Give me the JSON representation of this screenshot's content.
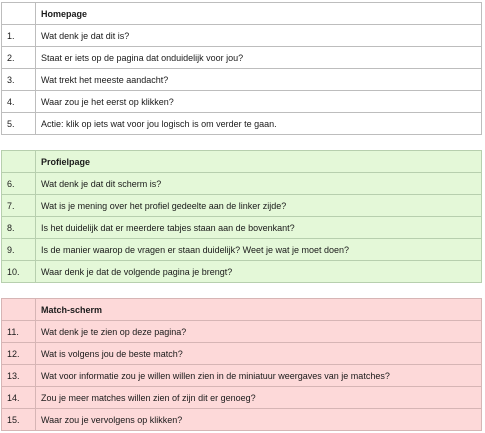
{
  "sections": [
    {
      "title": "Homepage",
      "rows": [
        {
          "num": "1.",
          "text": "Wat denk je dat dit is?"
        },
        {
          "num": "2.",
          "text": "Staat er iets op de pagina dat onduidelijk voor jou?"
        },
        {
          "num": "3.",
          "text": "Wat trekt het meeste aandacht?"
        },
        {
          "num": "4.",
          "text": "Waar zou je het eerst op klikken?"
        },
        {
          "num": "5.",
          "text": "Actie: klik op iets wat voor jou logisch is om verder te gaan."
        }
      ]
    },
    {
      "title": "Profielpage",
      "rows": [
        {
          "num": "6.",
          "text": "Wat denk je dat dit scherm is?"
        },
        {
          "num": "7.",
          "text": "Wat is je mening over het profiel gedeelte aan de linker zijde?"
        },
        {
          "num": "8.",
          "text": "Is het duidelijk dat er meerdere tabjes staan aan de bovenkant?"
        },
        {
          "num": "9.",
          "text": "Is de manier waarop de vragen er staan duidelijk? Weet je wat je moet doen?"
        },
        {
          "num": "10.",
          "text": "Waar denk je dat de volgende pagina je brengt?"
        }
      ]
    },
    {
      "title": "Match-scherm",
      "rows": [
        {
          "num": "11.",
          "text": "Wat denk je te zien op deze pagina?"
        },
        {
          "num": "12.",
          "text": "Wat is volgens jou de beste match?"
        },
        {
          "num": "13.",
          "text": "Wat voor informatie zou je willen willen zien in de miniatuur weergaves van je matches?"
        },
        {
          "num": "14.",
          "text": "Zou je meer matches willen zien of zijn dit er genoeg?"
        },
        {
          "num": "15.",
          "text": "Waar zou je vervolgens op klikken?"
        }
      ]
    }
  ]
}
